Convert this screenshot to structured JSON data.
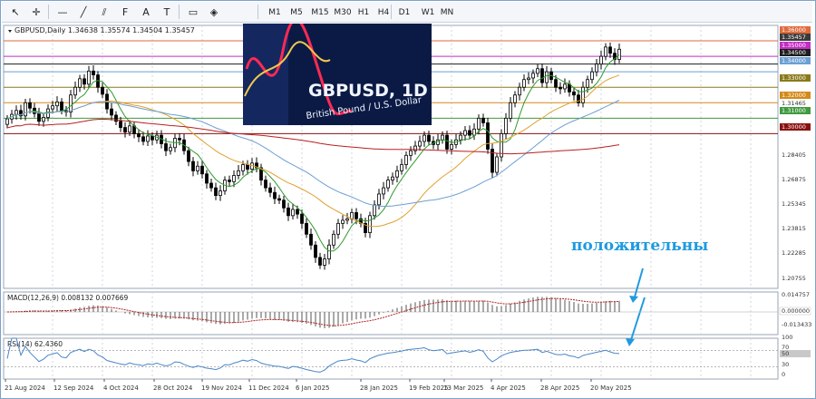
{
  "toolbar": {
    "tools": [
      {
        "name": "cursor-icon",
        "glyph": "↖"
      },
      {
        "name": "crosshair-icon",
        "glyph": "✛"
      },
      {
        "name": "hline-icon",
        "glyph": "—"
      },
      {
        "name": "trendline-icon",
        "glyph": "╱"
      },
      {
        "name": "channel-icon",
        "glyph": "⫽"
      },
      {
        "name": "fibo-icon",
        "glyph": "F"
      },
      {
        "name": "text-icon",
        "glyph": "A"
      },
      {
        "name": "label-icon",
        "glyph": "T"
      },
      {
        "name": "rectangle-icon",
        "glyph": "▭"
      },
      {
        "name": "shapes-icon",
        "glyph": "◈"
      }
    ],
    "timeframes": [
      "M1",
      "M5",
      "M15",
      "M30",
      "H1",
      "H4",
      "D1",
      "W1",
      "MN"
    ]
  },
  "chart": {
    "symbol_line": "GBPUSD,Daily  1.34638 1.35574 1.34504 1.35457",
    "price_axis": [
      {
        "label": "1.36000",
        "color": "#e06a3c",
        "boxed": true
      },
      {
        "label": "1.35457",
        "color": "#3a3a3a",
        "boxed": true
      },
      {
        "label": "1.35000",
        "color": "#c22ec2",
        "boxed": true
      },
      {
        "label": "1.34500",
        "color": "#1e1e1e",
        "boxed": true
      },
      {
        "label": "1.34000",
        "color": "#6c9fd4",
        "boxed": true
      },
      {
        "label": "1.33000",
        "color": "#8a7a1a",
        "boxed": true
      },
      {
        "label": "1.32000",
        "color": "#d38a1a",
        "boxed": true
      },
      {
        "label": "1.31465",
        "color": "",
        "boxed": false
      },
      {
        "label": "1.31000",
        "color": "#3f9a3f",
        "boxed": true
      },
      {
        "label": "1.30000",
        "color": "#8a1010",
        "boxed": true
      },
      {
        "label": "1.28405",
        "color": "",
        "boxed": false
      },
      {
        "label": "1.26875",
        "color": "",
        "boxed": false
      },
      {
        "label": "1.25345",
        "color": "",
        "boxed": false
      },
      {
        "label": "1.23815",
        "color": "",
        "boxed": false
      },
      {
        "label": "1.22285",
        "color": "",
        "boxed": false
      },
      {
        "label": "1.20755",
        "color": "",
        "boxed": false
      }
    ],
    "levels": [
      {
        "price": 1.36,
        "color": "#e06a3c"
      },
      {
        "price": 1.35,
        "color": "#c22ec2"
      },
      {
        "price": 1.345,
        "color": "#1e1e1e"
      },
      {
        "price": 1.34,
        "color": "#6c9fd4"
      },
      {
        "price": 1.33,
        "color": "#8a7a1a"
      },
      {
        "price": 1.32,
        "color": "#d38a1a"
      },
      {
        "price": 1.31,
        "color": "#3f9a3f"
      },
      {
        "price": 1.3,
        "color": "#8a1010"
      }
    ],
    "date_axis": [
      "21 Aug 2024",
      "12 Sep 2024",
      "4 Oct 2024",
      "28 Oct 2024",
      "19 Nov 2024",
      "11 Dec 2024",
      "6 Jan 2025",
      "28 Jan 2025",
      "19 Feb 2025",
      "13 Mar 2025",
      "4 Apr 2025",
      "28 Apr 2025",
      "20 May 2025"
    ],
    "inset_image": {
      "title": "GBPUSD, 1D",
      "subtitle": "British Pound / U.S. Dollar"
    },
    "annotation": "положительны",
    "annotation_color": "#1f9ae0",
    "macd": {
      "label": "MACD(12,26,9) 0.008132 0.007669",
      "axis": [
        "0.014757",
        "0.000000",
        "-0.013433"
      ]
    },
    "rsi": {
      "label": "RSI(14) 62.4360",
      "axis": [
        "100",
        "70",
        "50",
        "30",
        "0"
      ],
      "value": 62.436
    },
    "series_colors": {
      "ma_fast": "#2e9a2e",
      "ma_mid": "#e0a030",
      "ma_slow": "#6c9fd4",
      "ma_long": "#b82020",
      "rsi": "#4a86c8",
      "macd_signal": "#b02020"
    }
  },
  "chart_data": {
    "type": "candlestick",
    "title": "GBPUSD,Daily",
    "ylim": [
      1.2,
      1.37
    ],
    "closes": [
      1.3095,
      1.3125,
      1.315,
      1.3115,
      1.32,
      1.3165,
      1.313,
      1.308,
      1.3105,
      1.316,
      1.318,
      1.3205,
      1.315,
      1.314,
      1.325,
      1.33,
      1.3355,
      1.332,
      1.3405,
      1.338,
      1.33,
      1.3255,
      1.316,
      1.312,
      1.308,
      1.304,
      1.301,
      1.305,
      1.3,
      1.298,
      1.295,
      1.2985,
      1.296,
      1.299,
      1.2935,
      1.289,
      1.291,
      1.297,
      1.296,
      1.289,
      1.282,
      1.276,
      1.279,
      1.274,
      1.268,
      1.265,
      1.26,
      1.263,
      1.27,
      1.269,
      1.273,
      1.276,
      1.28,
      1.277,
      1.281,
      1.278,
      1.27,
      1.265,
      1.262,
      1.258,
      1.257,
      1.252,
      1.247,
      1.251,
      1.248,
      1.242,
      1.235,
      1.228,
      1.22,
      1.215,
      1.219,
      1.228,
      1.235,
      1.242,
      1.244,
      1.245,
      1.249,
      1.245,
      1.242,
      1.236,
      1.247,
      1.254,
      1.261,
      1.265,
      1.27,
      1.272,
      1.276,
      1.28,
      1.286,
      1.289,
      1.292,
      1.295,
      1.299,
      1.295,
      1.293,
      1.296,
      1.299,
      1.29,
      1.293,
      1.296,
      1.299,
      1.302,
      1.299,
      1.303,
      1.31,
      1.307,
      1.29,
      1.275,
      1.285,
      1.3,
      1.31,
      1.32,
      1.325,
      1.33,
      1.335,
      1.336,
      1.339,
      1.342,
      1.333,
      1.34,
      1.335,
      1.33,
      1.329,
      1.332,
      1.327,
      1.325,
      1.32,
      1.33,
      1.335,
      1.34,
      1.345,
      1.35,
      1.356,
      1.352,
      1.348,
      1.3546
    ]
  }
}
